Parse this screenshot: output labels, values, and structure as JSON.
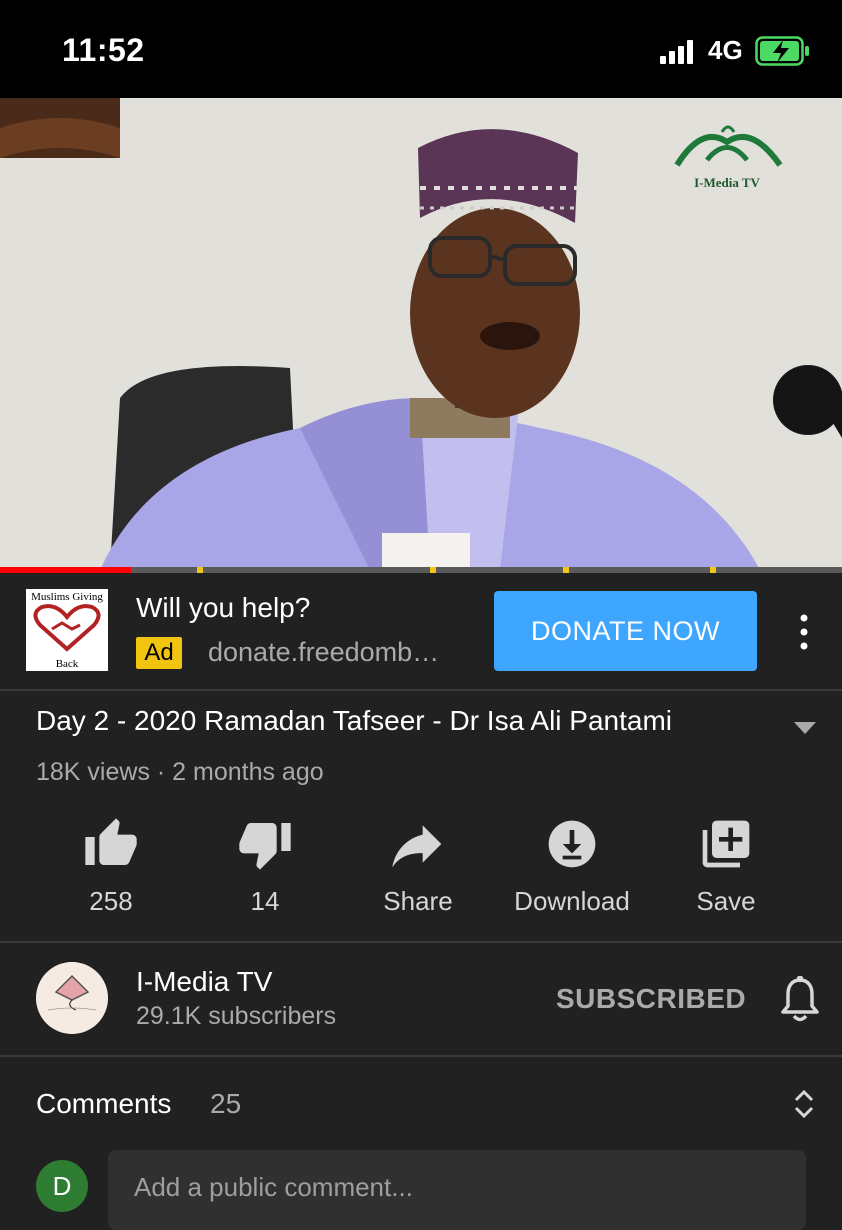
{
  "status_bar": {
    "time": "11:52",
    "network": "4G"
  },
  "video": {
    "watermark": "I-Media TV",
    "progress_fraction": 0.155
  },
  "ad": {
    "thumb_text_top": "Muslims Giving",
    "thumb_text_bottom": "Back",
    "title": "Will you help?",
    "badge": "Ad",
    "url": "donate.freedomb…",
    "cta": "DONATE NOW"
  },
  "video_info": {
    "title": "Day 2 - 2020 Ramadan Tafseer - Dr Isa Ali Pantami",
    "meta": "18K views · 2 months ago"
  },
  "actions": {
    "like": "258",
    "dislike": "14",
    "share": "Share",
    "download": "Download",
    "save": "Save"
  },
  "channel": {
    "name": "I-Media TV",
    "subscribers": "29.1K subscribers",
    "subscribe_state": "SUBSCRIBED",
    "avatar_text": "I-Media TV"
  },
  "comments": {
    "label": "Comments",
    "count": "25",
    "user_initial": "D",
    "placeholder": "Add a public comment..."
  },
  "colors": {
    "background": "#212121",
    "accent_blue": "#3ea6ff",
    "progress_red": "#ff0000",
    "ad_yellow": "#f1c40f",
    "avatar_green": "#2e7d32"
  }
}
